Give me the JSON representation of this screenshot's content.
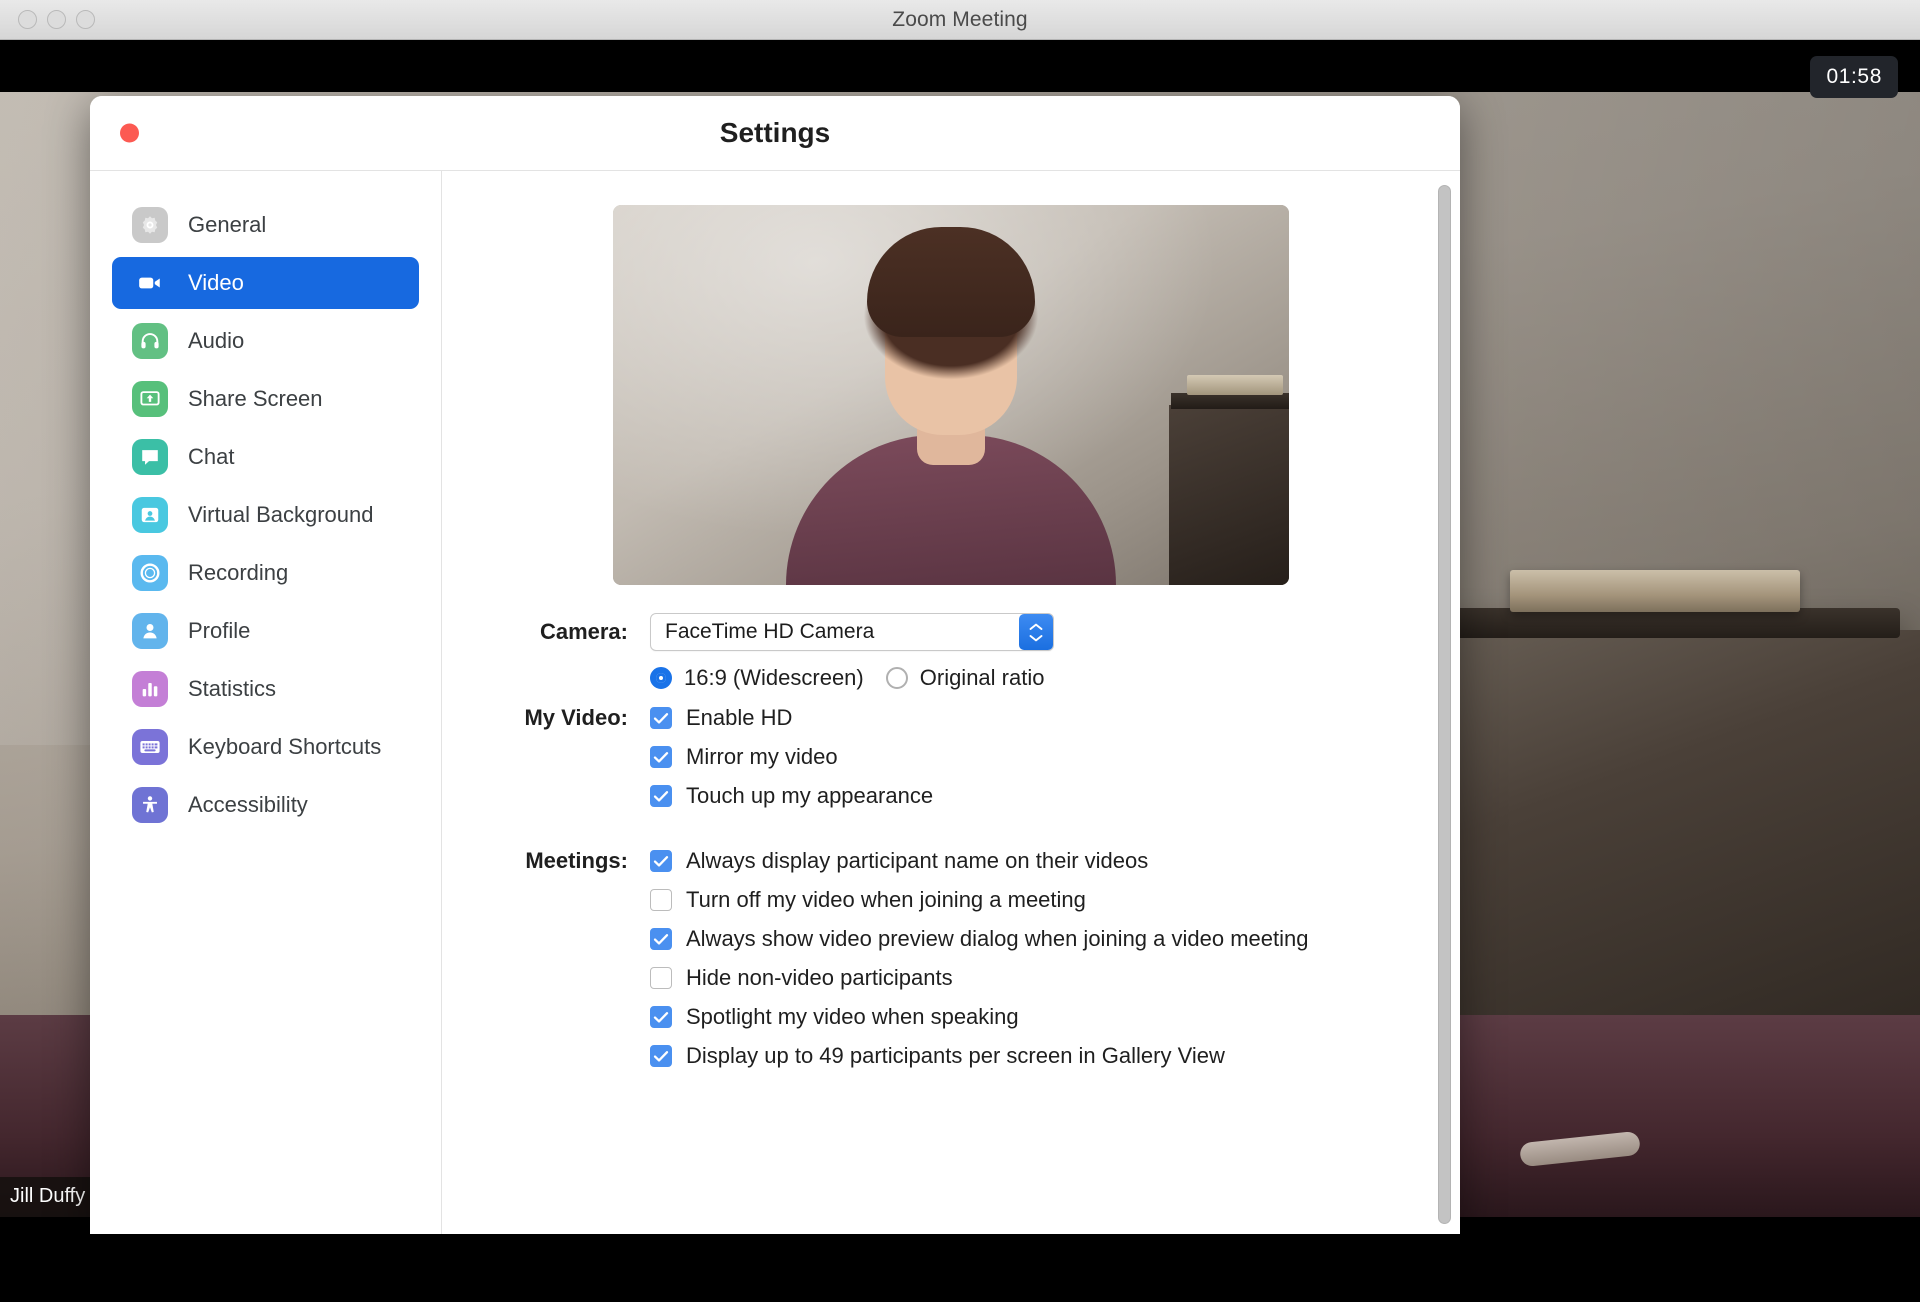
{
  "window": {
    "title": "Zoom Meeting",
    "traffic_lights": [
      "close",
      "minimize",
      "maximize"
    ]
  },
  "meeting": {
    "timer": "01:58",
    "participant_name": "Jill Duffy"
  },
  "settings": {
    "title": "Settings",
    "sidebar": {
      "items": [
        {
          "label": "General",
          "icon": "gear-icon",
          "color": "#c9c9c9",
          "active": false
        },
        {
          "label": "Video",
          "icon": "video-camera-icon",
          "color": "#1769e0",
          "active": true
        },
        {
          "label": "Audio",
          "icon": "headphones-icon",
          "color": "#62c083",
          "active": false
        },
        {
          "label": "Share Screen",
          "icon": "share-screen-icon",
          "color": "#57c07b",
          "active": false
        },
        {
          "label": "Chat",
          "icon": "chat-bubble-icon",
          "color": "#3bbfa6",
          "active": false
        },
        {
          "label": "Virtual Background",
          "icon": "virtual-background-icon",
          "color": "#49c8e0",
          "active": false
        },
        {
          "label": "Recording",
          "icon": "record-circle-icon",
          "color": "#5ab9ef",
          "active": false
        },
        {
          "label": "Profile",
          "icon": "person-icon",
          "color": "#62b4ec",
          "active": false
        },
        {
          "label": "Statistics",
          "icon": "bar-chart-icon",
          "color": "#c47fd6",
          "active": false
        },
        {
          "label": "Keyboard Shortcuts",
          "icon": "keyboard-icon",
          "color": "#7b73d8",
          "active": false
        },
        {
          "label": "Accessibility",
          "icon": "accessibility-icon",
          "color": "#6f73d4",
          "active": false
        }
      ]
    },
    "video_panel": {
      "camera": {
        "label": "Camera:",
        "selected": "FaceTime HD Camera"
      },
      "aspect_ratio": {
        "options": [
          {
            "label": "16:9 (Widescreen)",
            "selected": true
          },
          {
            "label": "Original ratio",
            "selected": false
          }
        ]
      },
      "my_video": {
        "label": "My Video:",
        "options": [
          {
            "label": "Enable HD",
            "checked": true
          },
          {
            "label": "Mirror my video",
            "checked": true
          },
          {
            "label": "Touch up my appearance",
            "checked": true
          }
        ]
      },
      "meetings": {
        "label": "Meetings:",
        "options": [
          {
            "label": "Always display participant name on their videos",
            "checked": true
          },
          {
            "label": "Turn off my video when joining a meeting",
            "checked": false
          },
          {
            "label": "Always show video preview dialog when joining a video meeting",
            "checked": true
          },
          {
            "label": "Hide non-video participants",
            "checked": false
          },
          {
            "label": "Spotlight my video when speaking",
            "checked": true
          },
          {
            "label": "Display up to 49 participants per screen in Gallery View",
            "checked": true
          }
        ]
      }
    }
  },
  "colors": {
    "accent": "#1769e0",
    "checkbox": "#4a90f0",
    "radio": "#1a73e8",
    "close_red": "#fc5a52"
  }
}
